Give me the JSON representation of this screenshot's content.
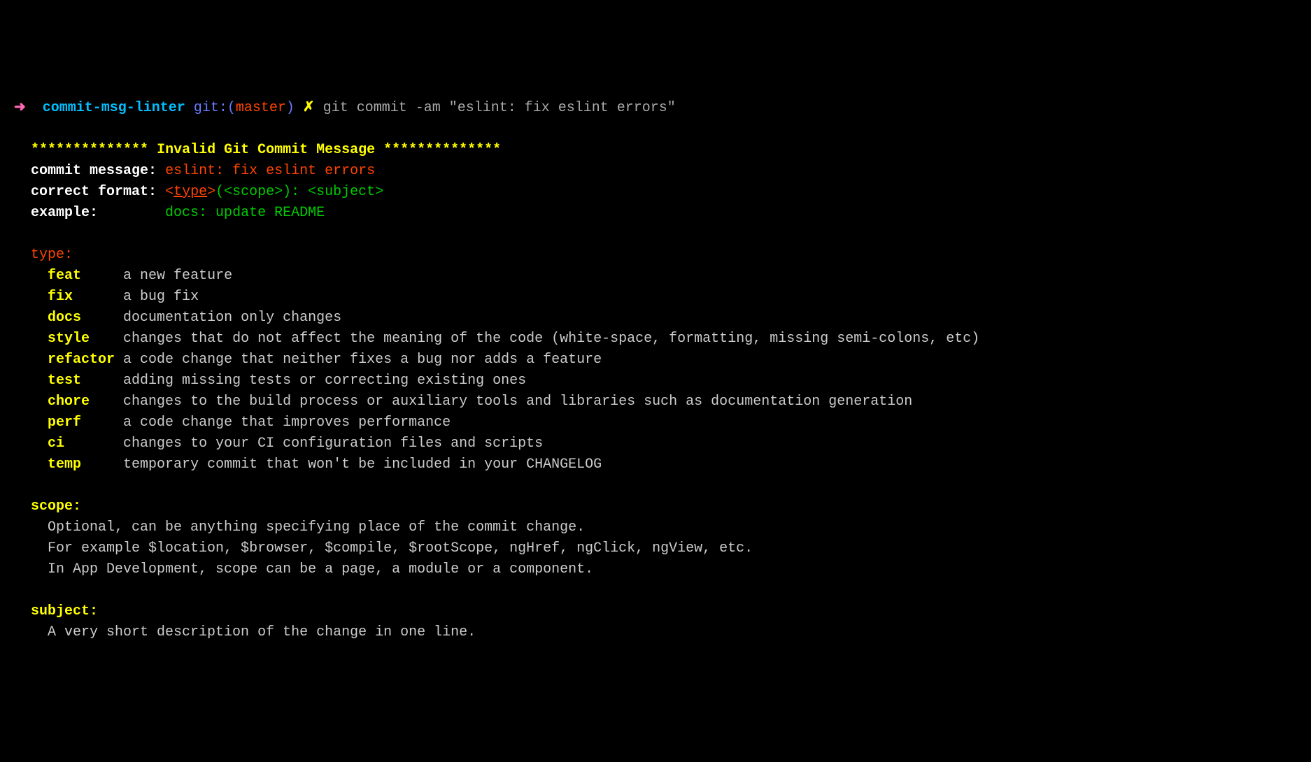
{
  "prompt": {
    "arrow": "➜",
    "project": "commit-msg-linter",
    "git_label": "git:",
    "paren_open": "(",
    "branch": "master",
    "paren_close": ")",
    "lightning": "✗",
    "command": "git commit -am \"eslint: fix eslint errors\""
  },
  "header": {
    "stars_open": "**************",
    "title": "Invalid Git Commit Message",
    "stars_close": "**************"
  },
  "commit_message": {
    "label": "commit message:",
    "value": "eslint: fix eslint errors"
  },
  "correct_format": {
    "label": "correct format:",
    "type_open": "<",
    "type_word": "type",
    "type_close": ">",
    "paren_open": "(",
    "scope": "<scope>",
    "paren_close": ")",
    "colon": ": ",
    "subject": "<subject>"
  },
  "example": {
    "label": "example:",
    "value": "docs: update README"
  },
  "type_section": {
    "header": "type:",
    "items": [
      {
        "name": "feat",
        "desc": "a new feature"
      },
      {
        "name": "fix",
        "desc": "a bug fix"
      },
      {
        "name": "docs",
        "desc": "documentation only changes"
      },
      {
        "name": "style",
        "desc": "changes that do not affect the meaning of the code (white-space, formatting, missing semi-colons, etc)"
      },
      {
        "name": "refactor",
        "desc": "a code change that neither fixes a bug nor adds a feature"
      },
      {
        "name": "test",
        "desc": "adding missing tests or correcting existing ones"
      },
      {
        "name": "chore",
        "desc": "changes to the build process or auxiliary tools and libraries such as documentation generation"
      },
      {
        "name": "perf",
        "desc": "a code change that improves performance"
      },
      {
        "name": "ci",
        "desc": "changes to your CI configuration files and scripts"
      },
      {
        "name": "temp",
        "desc": "temporary commit that won't be included in your CHANGELOG"
      }
    ]
  },
  "scope_section": {
    "header": "scope:",
    "lines": [
      "Optional, can be anything specifying place of the commit change.",
      "For example $location, $browser, $compile, $rootScope, ngHref, ngClick, ngView, etc.",
      "In App Development, scope can be a page, a module or a component."
    ]
  },
  "subject_section": {
    "header": "subject:",
    "lines": [
      "A very short description of the change in one line."
    ]
  }
}
